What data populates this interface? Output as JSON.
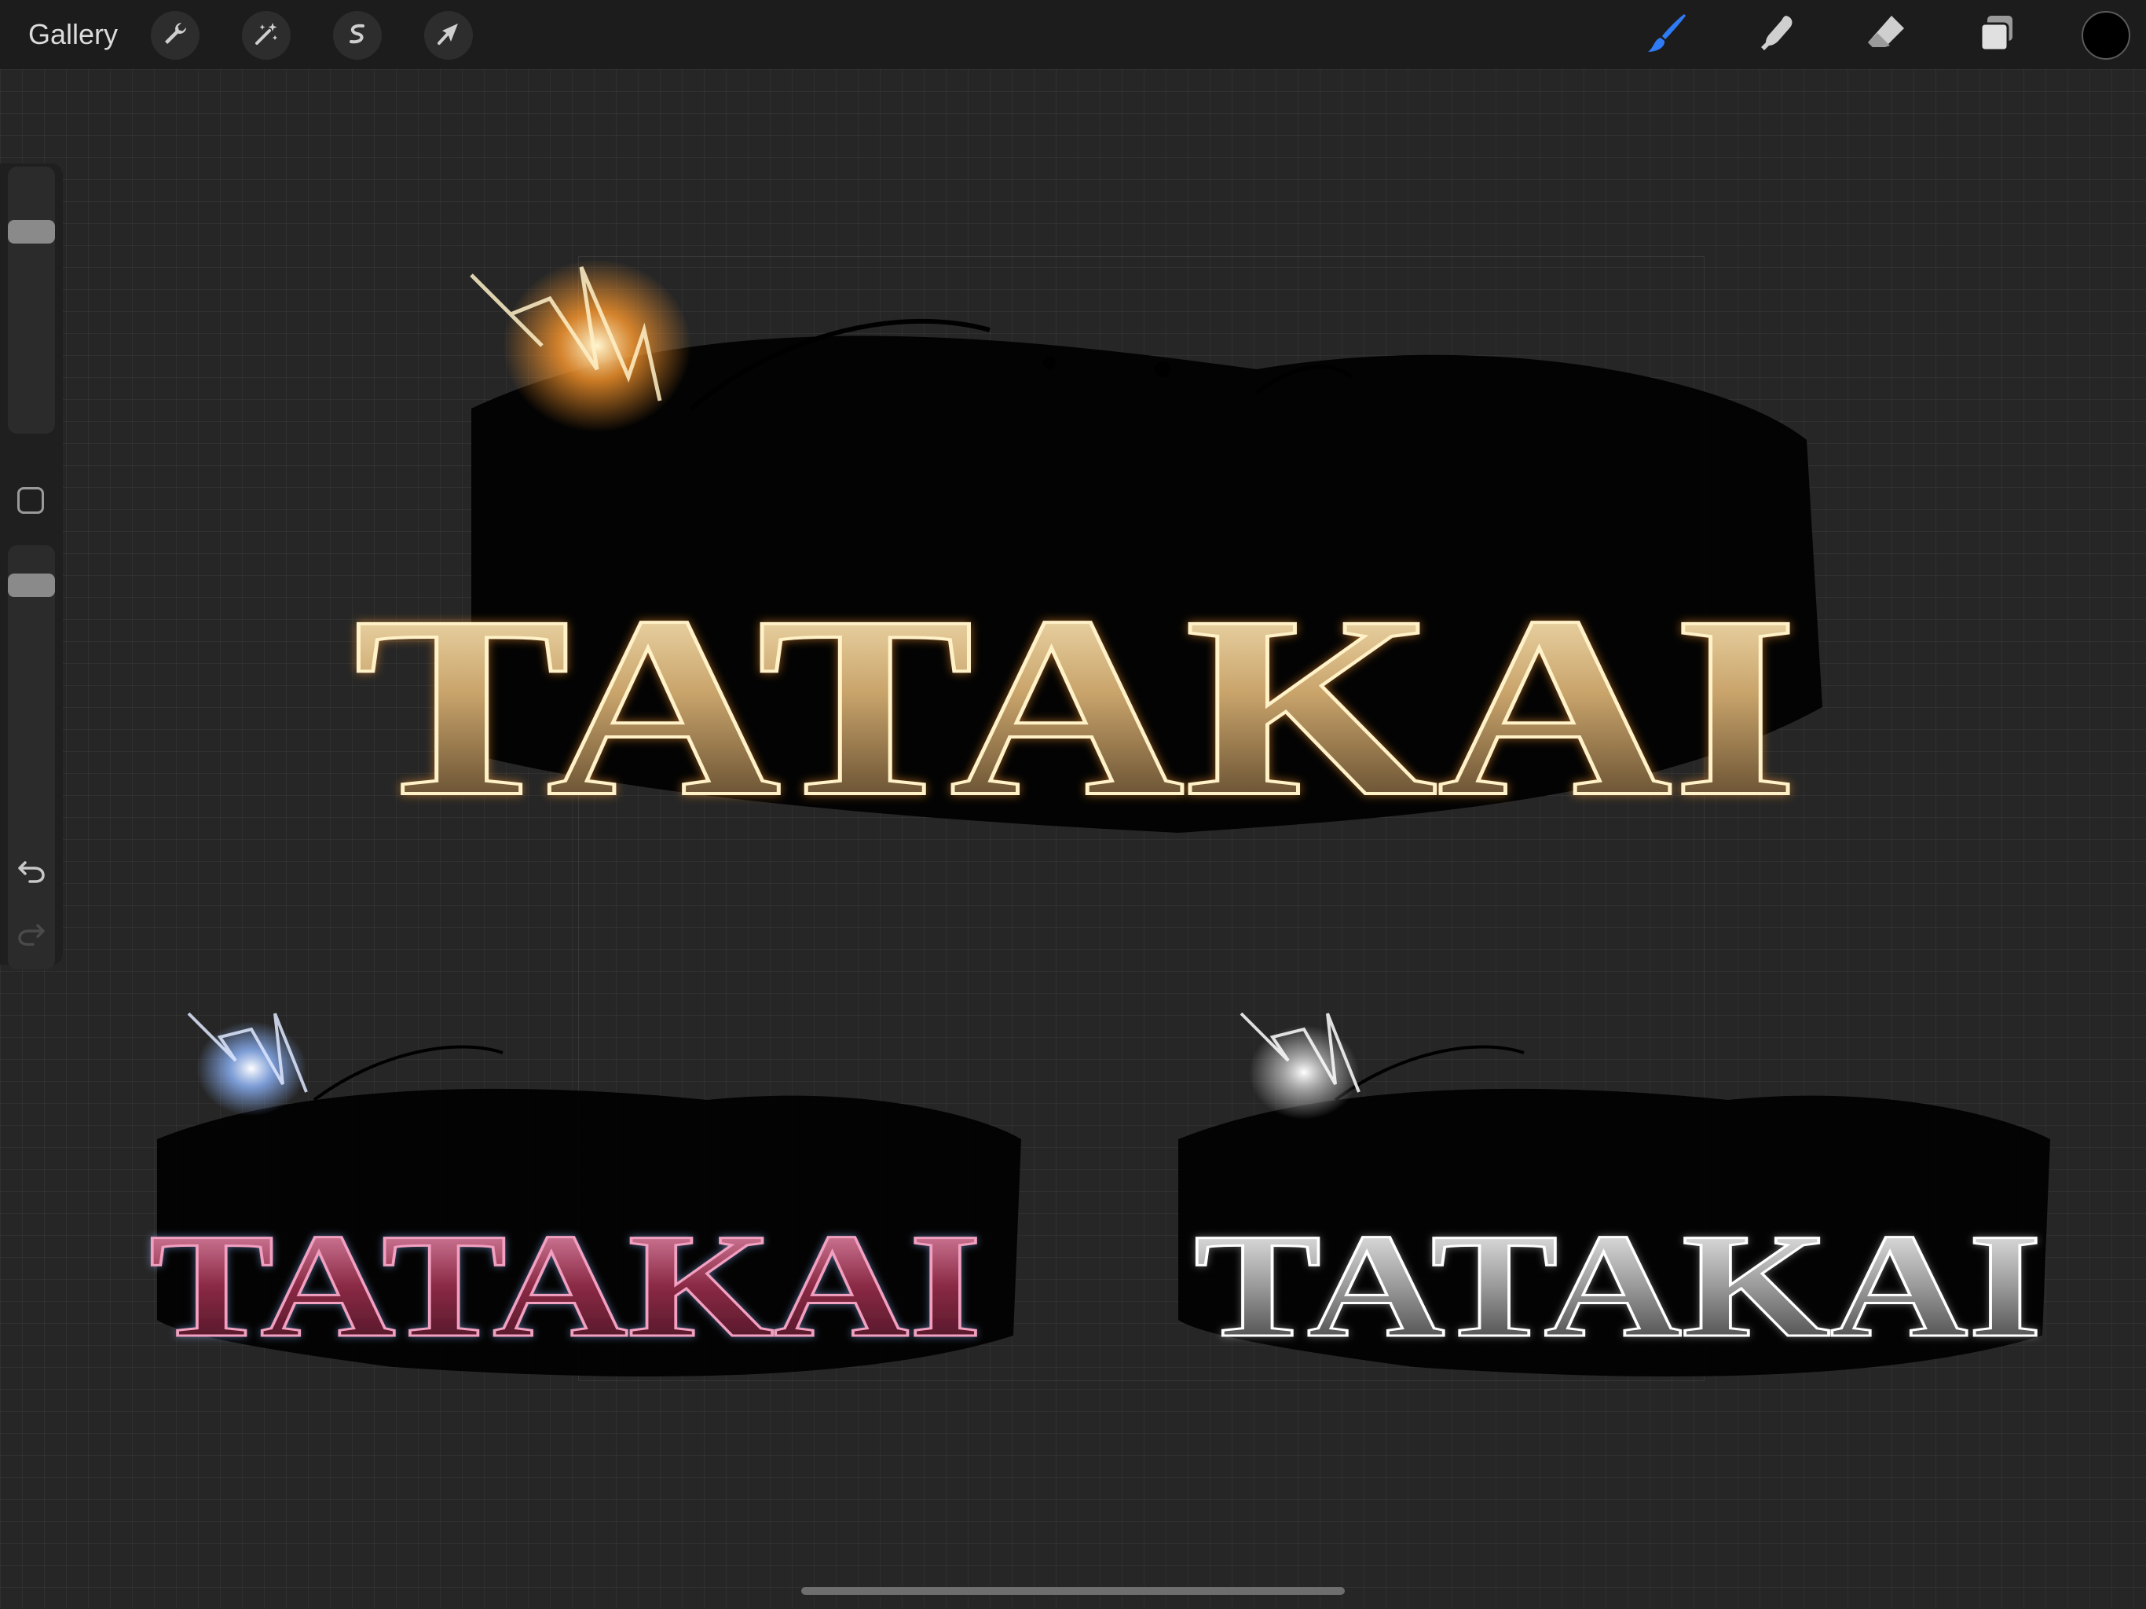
{
  "toolbar": {
    "gallery_label": "Gallery",
    "left_tools": [
      {
        "name": "actions",
        "icon": "wrench-icon"
      },
      {
        "name": "adjustments",
        "icon": "magic-wand-icon"
      },
      {
        "name": "selection",
        "icon": "selection-s-icon"
      },
      {
        "name": "transform",
        "icon": "arrow-cursor-icon"
      }
    ],
    "right_tools": [
      {
        "name": "brush",
        "icon": "brush-icon",
        "active": true
      },
      {
        "name": "smudge",
        "icon": "smudge-finger-icon"
      },
      {
        "name": "eraser",
        "icon": "eraser-icon"
      },
      {
        "name": "layers",
        "icon": "layers-icon"
      }
    ],
    "active_color": "#000000",
    "accent_color": "#2f7bf5"
  },
  "sidebar": {
    "brush_size": 0.22,
    "brush_opacity": 0.93
  },
  "artwork": {
    "pieces": [
      {
        "text": "TATAKAI",
        "palette": "gold"
      },
      {
        "text": "TATAKAI",
        "palette": "red-blue"
      },
      {
        "text": "TATAKAI",
        "palette": "silver"
      }
    ],
    "colors": {
      "gold_light": "#fff1c8",
      "gold_mid": "#c9a46b",
      "gold_dark": "#3b2a18",
      "fire": "#ff9a2e",
      "red_light": "#f2a0c0",
      "red_dark": "#3a0f1c",
      "electric": "#8fb7ff",
      "silver_light": "#ffffff",
      "silver_dark": "#2a2a2a"
    }
  }
}
